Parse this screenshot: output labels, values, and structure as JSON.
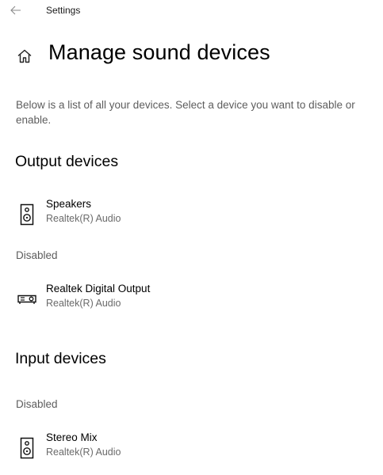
{
  "window": {
    "title": "Settings"
  },
  "icons": {
    "back": "back-arrow-icon",
    "home": "home-icon",
    "speaker": "speaker-icon",
    "digital_output": "digital-output-icon"
  },
  "page": {
    "title": "Manage sound devices",
    "description": "Below is a list of all your devices. Select a device you want to disable or enable."
  },
  "output": {
    "header": "Output devices",
    "enabled_devices": [
      {
        "name": "Speakers",
        "driver": "Realtek(R) Audio",
        "icon": "speaker-icon"
      }
    ],
    "disabled_label": "Disabled",
    "disabled_devices": [
      {
        "name": "Realtek Digital Output",
        "driver": "Realtek(R) Audio",
        "icon": "digital-output-icon"
      }
    ]
  },
  "input": {
    "header": "Input devices",
    "disabled_label": "Disabled",
    "disabled_devices": [
      {
        "name": "Stereo Mix",
        "driver": "Realtek(R) Audio",
        "icon": "speaker-icon"
      }
    ]
  }
}
